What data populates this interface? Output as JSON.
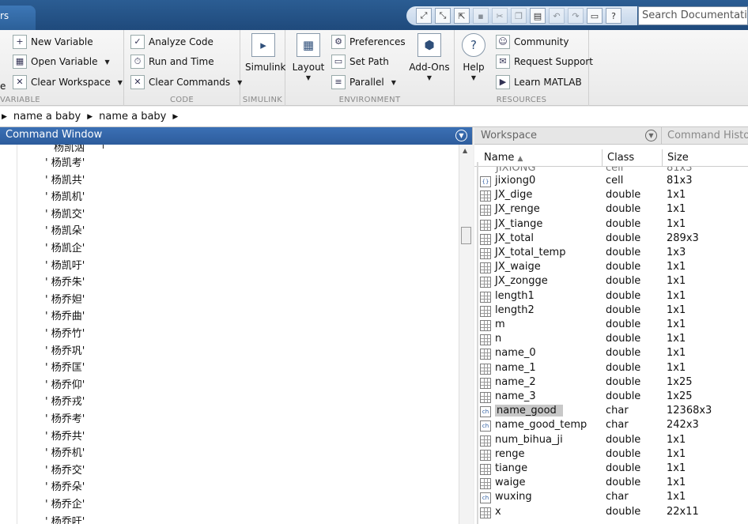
{
  "topbar": {
    "tab_label": "rs",
    "search_placeholder": "Search Documentation"
  },
  "ribbon": {
    "variable": {
      "label": "VARIABLE",
      "new_variable": "New Variable",
      "open_variable": "Open Variable",
      "clear_workspace": "Clear Workspace",
      "clipped_left": "e"
    },
    "code": {
      "label": "CODE",
      "analyze_code": "Analyze Code",
      "run_and_time": "Run and Time",
      "clear_commands": "Clear Commands"
    },
    "simulink": {
      "label": "SIMULINK",
      "simulink": "Simulink"
    },
    "environment": {
      "label": "ENVIRONMENT",
      "layout": "Layout",
      "preferences": "Preferences",
      "set_path": "Set Path",
      "parallel": "Parallel",
      "addons": "Add-Ons"
    },
    "resources": {
      "label": "RESOURCES",
      "help": "Help",
      "community": "Community",
      "request_support": "Request Support",
      "learn_matlab": "Learn MATLAB"
    }
  },
  "address": {
    "crumbs": [
      "name a baby",
      "name a baby"
    ]
  },
  "command_window": {
    "title": "Command Window",
    "clipped_top": "杨凯汹",
    "lines": [
      "' 杨凯考'",
      "' 杨凯共'",
      "' 杨凯机'",
      "' 杨凯交'",
      "' 杨凯朵'",
      "' 杨凯企'",
      "' 杨凯吁'",
      "' 杨乔朱'",
      "' 杨乔妲'",
      "' 杨乔曲'",
      "' 杨乔竹'",
      "' 杨乔巩'",
      "' 杨乔匡'",
      "' 杨乔仰'",
      "' 杨乔戎'",
      "' 杨乔考'",
      "' 杨乔共'",
      "' 杨乔机'",
      "' 杨乔交'",
      "' 杨乔朵'",
      "' 杨乔企'",
      "' 杨乔吁'"
    ]
  },
  "workspace": {
    "title": "Workspace",
    "other_tab": "Command History",
    "columns": {
      "name": "Name",
      "class": "Class",
      "size": "Size"
    },
    "clipped_row": {
      "name": "JIXIONG",
      "class": "cell",
      "size": "81x3"
    },
    "rows": [
      {
        "icon": "cell",
        "name": "jixiong0",
        "class": "cell",
        "size": "81x3"
      },
      {
        "icon": "grid",
        "name": "JX_dige",
        "class": "double",
        "size": "1x1"
      },
      {
        "icon": "grid",
        "name": "JX_renge",
        "class": "double",
        "size": "1x1"
      },
      {
        "icon": "grid",
        "name": "JX_tiange",
        "class": "double",
        "size": "1x1"
      },
      {
        "icon": "grid",
        "name": "JX_total",
        "class": "double",
        "size": "289x3"
      },
      {
        "icon": "grid",
        "name": "JX_total_temp",
        "class": "double",
        "size": "1x3"
      },
      {
        "icon": "grid",
        "name": "JX_waige",
        "class": "double",
        "size": "1x1"
      },
      {
        "icon": "grid",
        "name": "JX_zongge",
        "class": "double",
        "size": "1x1"
      },
      {
        "icon": "grid",
        "name": "length1",
        "class": "double",
        "size": "1x1"
      },
      {
        "icon": "grid",
        "name": "length2",
        "class": "double",
        "size": "1x1"
      },
      {
        "icon": "grid",
        "name": "m",
        "class": "double",
        "size": "1x1"
      },
      {
        "icon": "grid",
        "name": "n",
        "class": "double",
        "size": "1x1"
      },
      {
        "icon": "grid",
        "name": "name_0",
        "class": "double",
        "size": "1x1"
      },
      {
        "icon": "grid",
        "name": "name_1",
        "class": "double",
        "size": "1x1"
      },
      {
        "icon": "grid",
        "name": "name_2",
        "class": "double",
        "size": "1x25"
      },
      {
        "icon": "grid",
        "name": "name_3",
        "class": "double",
        "size": "1x25"
      },
      {
        "icon": "char",
        "name": "name_good",
        "class": "char",
        "size": "12368x3",
        "selected": true
      },
      {
        "icon": "char",
        "name": "name_good_temp",
        "class": "char",
        "size": "242x3"
      },
      {
        "icon": "grid",
        "name": "num_bihua_ji",
        "class": "double",
        "size": "1x1"
      },
      {
        "icon": "grid",
        "name": "renge",
        "class": "double",
        "size": "1x1"
      },
      {
        "icon": "grid",
        "name": "tiange",
        "class": "double",
        "size": "1x1"
      },
      {
        "icon": "grid",
        "name": "waige",
        "class": "double",
        "size": "1x1"
      },
      {
        "icon": "char",
        "name": "wuxing",
        "class": "char",
        "size": "1x1"
      },
      {
        "icon": "grid",
        "name": "x",
        "class": "double",
        "size": "22x11"
      }
    ]
  },
  "colors": {
    "title_blue": "#2d5c9c",
    "topbar": "#1f4a7c",
    "selection": "#c8c8c8"
  }
}
